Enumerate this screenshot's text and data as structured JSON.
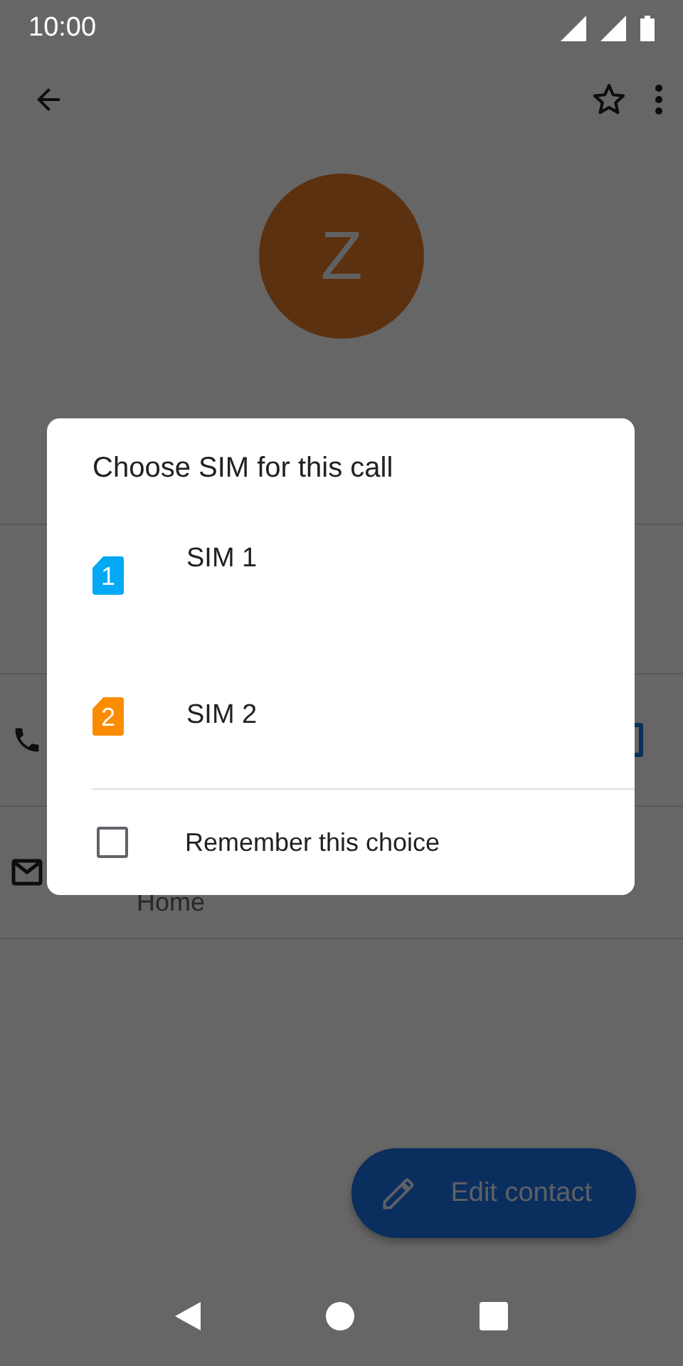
{
  "status_bar": {
    "time": "10:00"
  },
  "contact": {
    "initial": "Z",
    "email_label": "Home"
  },
  "fab": {
    "label": "Edit contact"
  },
  "dialog": {
    "title": "Choose SIM for this call",
    "options": [
      {
        "label": "SIM 1",
        "badge": "1",
        "color": "#03a9f4"
      },
      {
        "label": "SIM 2",
        "badge": "2",
        "color": "#fb8c00"
      }
    ],
    "remember": {
      "label": "Remember this choice",
      "checked": false
    }
  }
}
